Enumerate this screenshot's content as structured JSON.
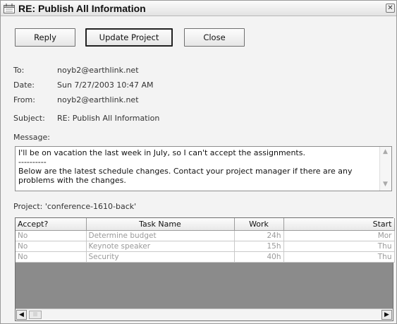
{
  "window": {
    "title": "RE: Publish All Information"
  },
  "toolbar": {
    "reply_label": "Reply",
    "update_label": "Update Project",
    "close_label": "Close"
  },
  "header": {
    "to_label": "To:",
    "to_value": "noyb2@earthlink.net",
    "date_label": "Date:",
    "date_value": "Sun 7/27/2003 10:47 AM",
    "from_label": "From:",
    "from_value": "noyb2@earthlink.net",
    "subject_label": "Subject:",
    "subject_value": "RE: Publish All Information"
  },
  "message": {
    "label": "Message:",
    "text": "I'll be on vacation the last week in July, so I can't accept the assignments.\n----------\nBelow are the latest schedule changes. Contact your project manager if there are any problems with the changes."
  },
  "project": {
    "label": "Project: 'conference-1610-back'"
  },
  "grid": {
    "columns": [
      "Accept?",
      "Task Name",
      "Work",
      "Start"
    ],
    "rows": [
      {
        "accept": "No",
        "task": "Determine budget",
        "work": "24h",
        "start": "Mor"
      },
      {
        "accept": "No",
        "task": "Keynote speaker",
        "work": "15h",
        "start": "Thu"
      },
      {
        "accept": "No",
        "task": "Security",
        "work": "40h",
        "start": "Thu"
      }
    ]
  },
  "icons": {
    "title": "calendar-icon",
    "close": "close-icon",
    "scroll_up": "chevron-up-icon",
    "scroll_down": "chevron-down-icon",
    "scroll_left": "chevron-left-icon",
    "scroll_right": "chevron-right-icon"
  }
}
